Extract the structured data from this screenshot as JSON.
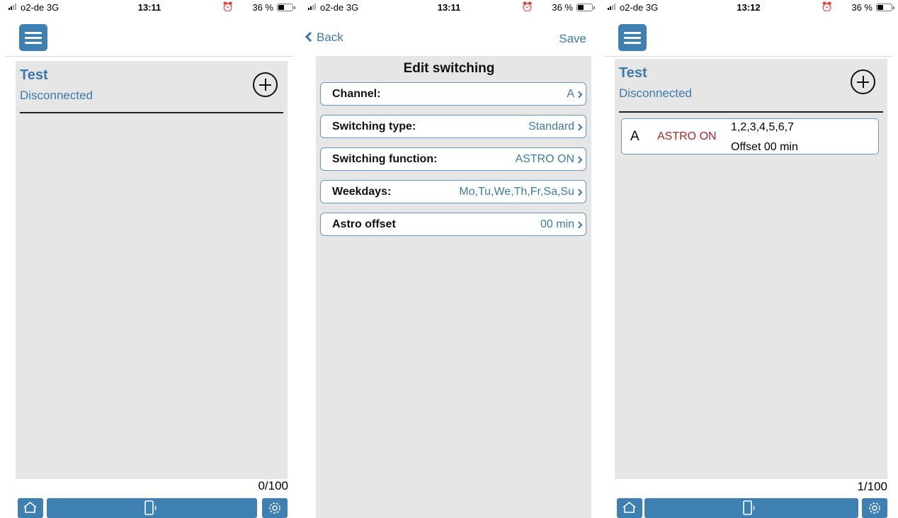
{
  "screens": [
    {
      "status": {
        "carrier": "o2-de  3G",
        "time": "13:11",
        "alarm": "⏰",
        "battery": "36 %"
      },
      "device": {
        "name": "Test",
        "state": "Disconnected"
      },
      "counter": "0/100"
    },
    {
      "status": {
        "carrier": "o2-de  3G",
        "time": "13:11",
        "alarm": "⏰",
        "battery": "36 %"
      },
      "nav": {
        "back_label": "Back",
        "save_label": "Save",
        "title": "Edit switching"
      },
      "rows": [
        {
          "label": "Channel:",
          "value": "A"
        },
        {
          "label": "Switching type:",
          "value": "Standard"
        },
        {
          "label": "Switching function:",
          "value": "ASTRO ON"
        },
        {
          "label": "Weekdays:",
          "value": "Mo,Tu,We,Th,Fr,Sa,Su"
        },
        {
          "label": "Astro offset",
          "value": "00 min"
        }
      ]
    },
    {
      "status": {
        "carrier": "o2-de  3G",
        "time": "13:12",
        "alarm": "⏰",
        "battery": "36 %"
      },
      "device": {
        "name": "Test",
        "state": "Disconnected"
      },
      "entries": [
        {
          "channel": "A",
          "function": "ASTRO ON",
          "days": "1,2,3,4,5,6,7",
          "offset": "Offset 00 min"
        }
      ],
      "counter": "1/100"
    }
  ],
  "colors": {
    "accent": "#3d80b1",
    "text_accent": "#3d7aa8",
    "astro": "#b2242b",
    "panel": "#e6e6e6"
  },
  "icons": [
    "menu-icon",
    "add-circle-icon",
    "home-icon",
    "phone-signal-icon",
    "gear-icon",
    "chevron-left-icon",
    "chevron-right-icon"
  ]
}
